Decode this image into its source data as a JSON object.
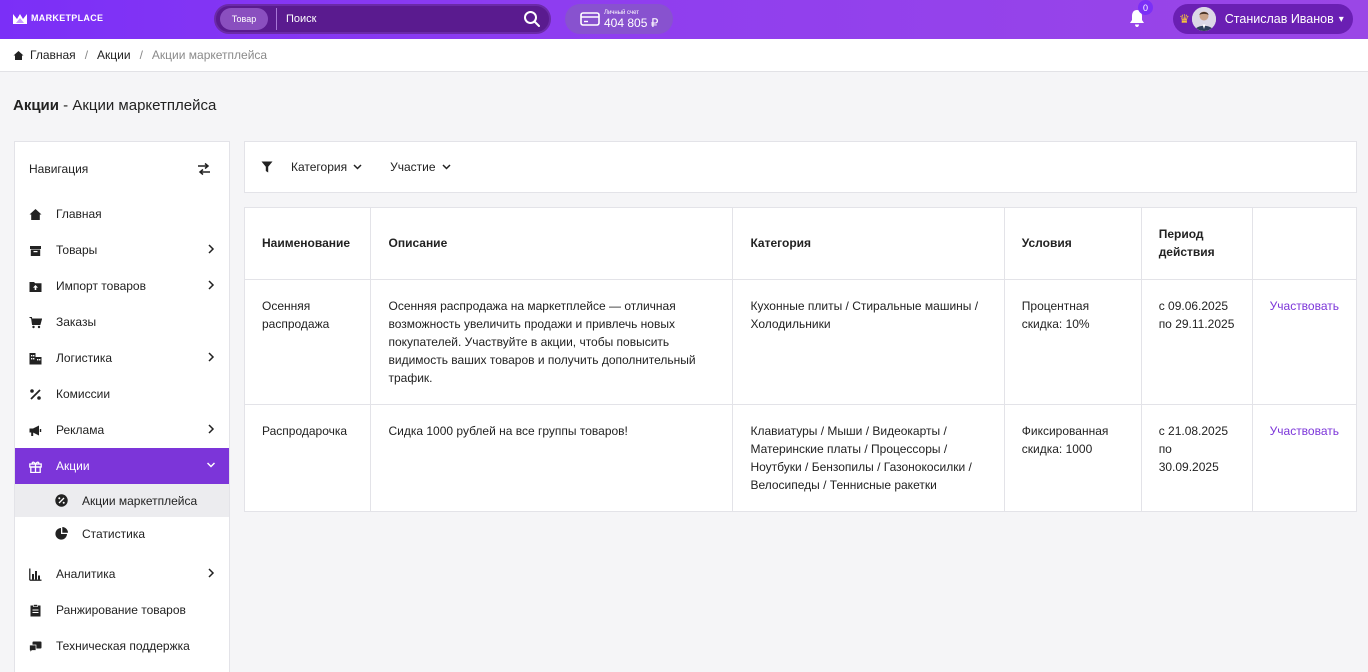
{
  "header": {
    "logo_text": "MARKETPLACE",
    "search_category": "Товар",
    "search_placeholder": "Поиск",
    "account_label": "Личный счет",
    "account_value": "404 805 ₽",
    "notifications_count": "0",
    "user_name": "Станислав Иванов",
    "accent_color": "#7b2ff7"
  },
  "breadcrumb": {
    "home": "Главная",
    "section": "Акции",
    "current": "Акции маркетплейса"
  },
  "page": {
    "title_bold": "Акции",
    "title_rest": " - Акции маркетплейса"
  },
  "sidebar": {
    "header": "Навигация",
    "items": [
      {
        "label": "Главная",
        "icon": "home-icon",
        "has_children": false
      },
      {
        "label": "Товары",
        "icon": "box-icon",
        "has_children": true
      },
      {
        "label": "Импорт товаров",
        "icon": "folder-upload-icon",
        "has_children": true
      },
      {
        "label": "Заказы",
        "icon": "cart-icon",
        "has_children": false
      },
      {
        "label": "Логистика",
        "icon": "warehouse-icon",
        "has_children": true
      },
      {
        "label": "Комиссии",
        "icon": "percent-icon",
        "has_children": false
      },
      {
        "label": "Реклама",
        "icon": "megaphone-icon",
        "has_children": true
      },
      {
        "label": "Акции",
        "icon": "gift-icon",
        "has_children": true,
        "active": true
      },
      {
        "label": "Аналитика",
        "icon": "bar-chart-icon",
        "has_children": true
      },
      {
        "label": "Ранжирование товаров",
        "icon": "clipboard-icon",
        "has_children": false
      },
      {
        "label": "Техническая поддержка",
        "icon": "chat-icon",
        "has_children": false
      }
    ],
    "subitems": [
      {
        "label": "Акции маркетплейса",
        "icon": "discount-icon",
        "active": true
      },
      {
        "label": "Статистика",
        "icon": "pie-icon",
        "active": false
      }
    ]
  },
  "filters": {
    "category": "Категория",
    "participation": "Участие"
  },
  "table": {
    "headers": [
      "Наименование",
      "Описание",
      "Категория",
      "Условия",
      "Период действия",
      ""
    ],
    "rows": [
      {
        "name": "Осенняя распродажа",
        "description": "Осенняя распродажа на маркетплейсе — отличная возможность увеличить продажи и привлечь новых покупателей. Участвуйте в акции, чтобы повысить видимость ваших товаров и получить дополнительный трафик.",
        "category": "Кухонные плиты / Стиральные машины / Холодильники",
        "conditions": "Процентная скидка: 10%",
        "period_from": "с 09.06.2025",
        "period_to": "по 29.11.2025",
        "action": "Участвовать"
      },
      {
        "name": "Распродарочка",
        "description": "Сидка 1000 рублей на все группы товаров!",
        "category": "Клавиатуры / Мыши / Видеокарты / Материнские платы / Процессоры / Ноутбуки / Бензопилы / Газонокосилки / Велосипеды / Теннисные ракетки",
        "conditions": "Фиксированная скидка: 1000",
        "period_from": "с 21.08.2025",
        "period_to": "по 30.09.2025",
        "action": "Участвовать"
      }
    ]
  }
}
